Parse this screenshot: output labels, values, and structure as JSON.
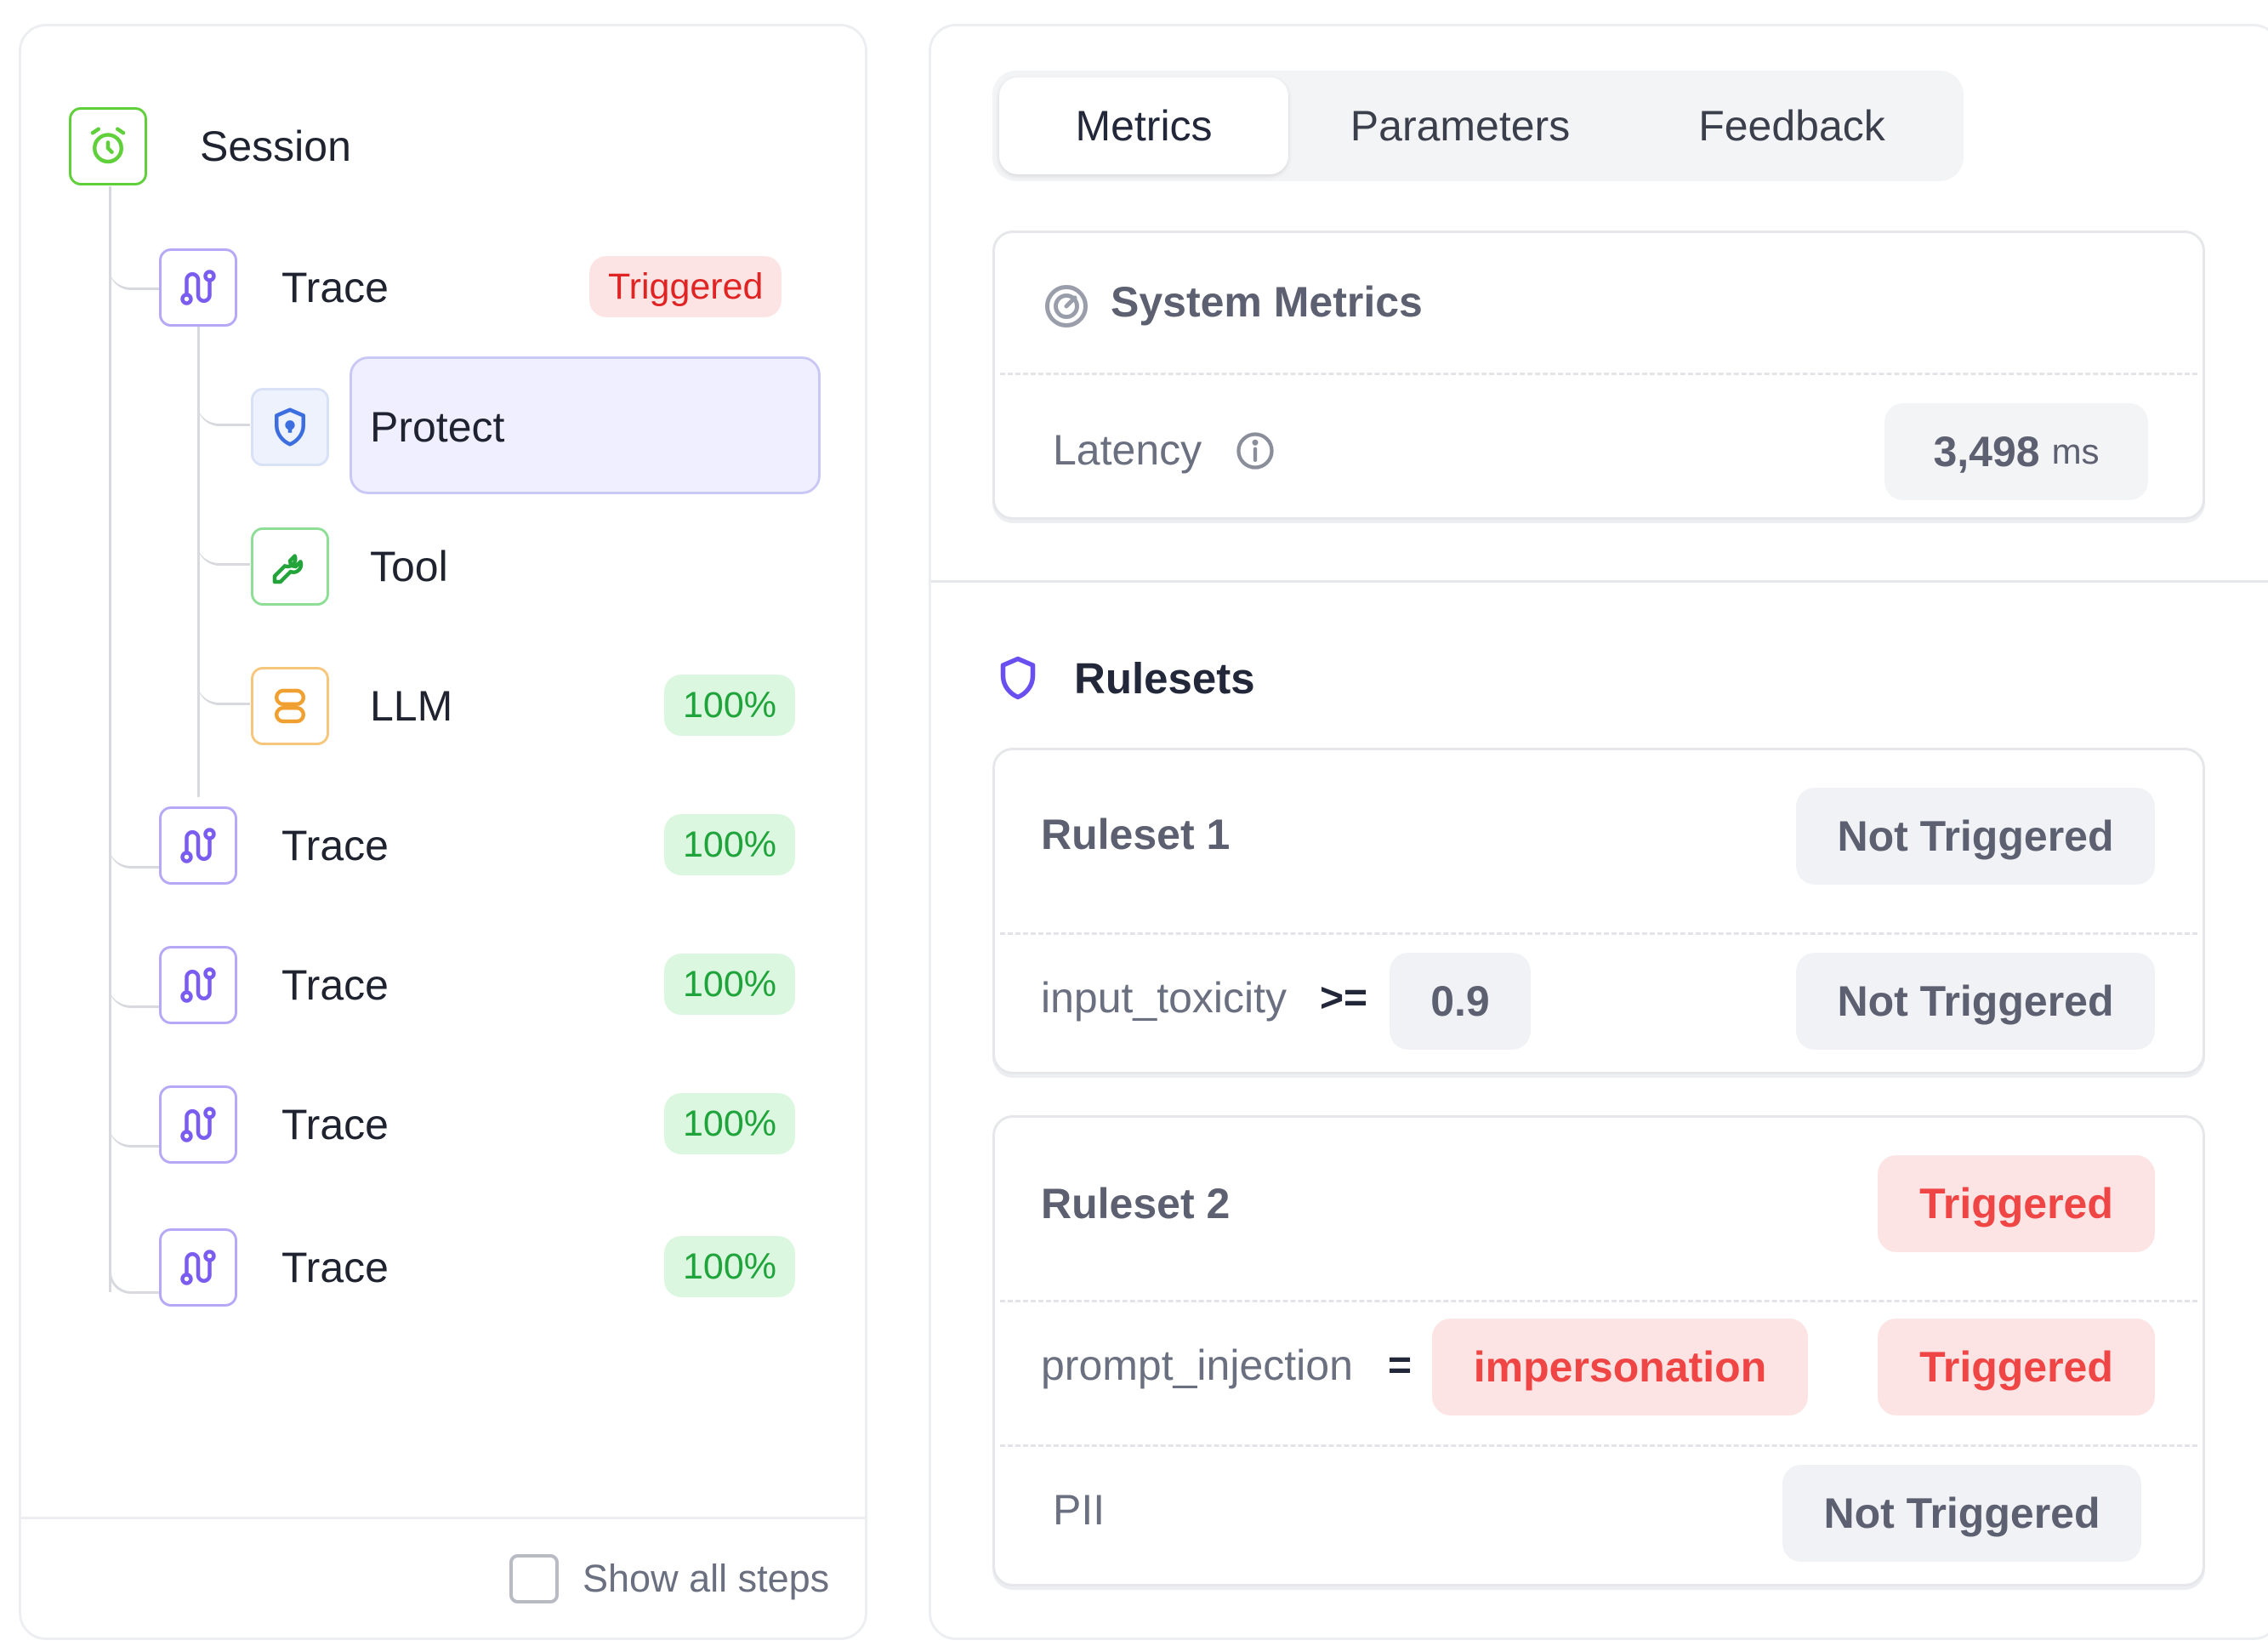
{
  "tree": {
    "session": {
      "label": "Session",
      "color": "#5fcf3a"
    },
    "nodes": [
      {
        "label": "Trace",
        "badge": "Triggered",
        "badge_type": "red"
      },
      {
        "label": "Protect",
        "badge": ""
      },
      {
        "label": "Tool",
        "badge": ""
      },
      {
        "label": "LLM",
        "badge": "100%",
        "badge_type": "green"
      },
      {
        "label": "Trace",
        "badge": "100%",
        "badge_type": "green"
      },
      {
        "label": "Trace",
        "badge": "100%",
        "badge_type": "green"
      },
      {
        "label": "Trace",
        "badge": "100%",
        "badge_type": "green"
      },
      {
        "label": "Trace",
        "badge": "100%",
        "badge_type": "green"
      }
    ],
    "show_all_steps": {
      "label": "Show all steps",
      "checked": false
    }
  },
  "tabs": [
    {
      "label": "Metrics",
      "active": true
    },
    {
      "label": "Parameters",
      "active": false
    },
    {
      "label": "Feedback",
      "active": false
    }
  ],
  "system_metrics": {
    "title": "System Metrics",
    "latency_label": "Latency",
    "latency_value": "3,498",
    "latency_unit": "ms"
  },
  "rulesets": {
    "title": "Rulesets",
    "items": [
      {
        "name": "Ruleset 1",
        "status": "Not Triggered",
        "rules": [
          {
            "metric": "input_toxicity",
            "operator": ">=",
            "value": "0.9",
            "status": "Not Triggered"
          }
        ]
      },
      {
        "name": "Ruleset 2",
        "status": "Triggered",
        "rules": [
          {
            "metric": "prompt_injection",
            "operator": "=",
            "value": "impersonation",
            "status": "Triggered"
          },
          {
            "metric": "PII",
            "operator": "",
            "value": "",
            "status": "Not Triggered"
          }
        ]
      }
    ]
  },
  "colors": {
    "trace": "#7b5cf0",
    "protect": "#3d6ee0",
    "tool": "#23a43a",
    "llm": "#f0a030",
    "triggered": "#f04545",
    "success": "#1ea43a"
  }
}
